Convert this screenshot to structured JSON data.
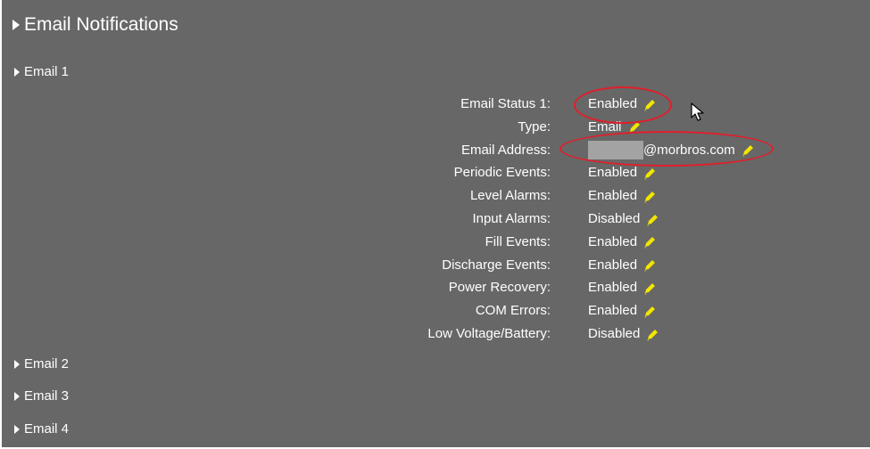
{
  "section": {
    "title": "Email Notifications"
  },
  "email1": {
    "title": "Email 1",
    "settings": [
      {
        "label": "Email Status 1:",
        "value": "Enabled"
      },
      {
        "label": "Type:",
        "value": "Email"
      },
      {
        "label": "Email Address:",
        "value": "@morbros.com"
      },
      {
        "label": "Periodic Events:",
        "value": "Enabled"
      },
      {
        "label": "Level Alarms:",
        "value": "Enabled"
      },
      {
        "label": "Input Alarms:",
        "value": "Disabled"
      },
      {
        "label": "Fill Events:",
        "value": "Enabled"
      },
      {
        "label": "Discharge Events:",
        "value": "Enabled"
      },
      {
        "label": "Power Recovery:",
        "value": "Enabled"
      },
      {
        "label": "COM Errors:",
        "value": "Enabled"
      },
      {
        "label": "Low Voltage/Battery:",
        "value": "Disabled"
      }
    ]
  },
  "other_emails": [
    {
      "title": "Email 2"
    },
    {
      "title": "Email 3"
    },
    {
      "title": "Email 4"
    }
  ],
  "colors": {
    "panel_bg": "#676767",
    "pencil": "#f2e600",
    "annotation_red": "#e01f2a"
  },
  "icons": {
    "expand": "caret-right-icon",
    "edit": "pencil-icon",
    "pointer": "mouse-cursor-icon"
  }
}
